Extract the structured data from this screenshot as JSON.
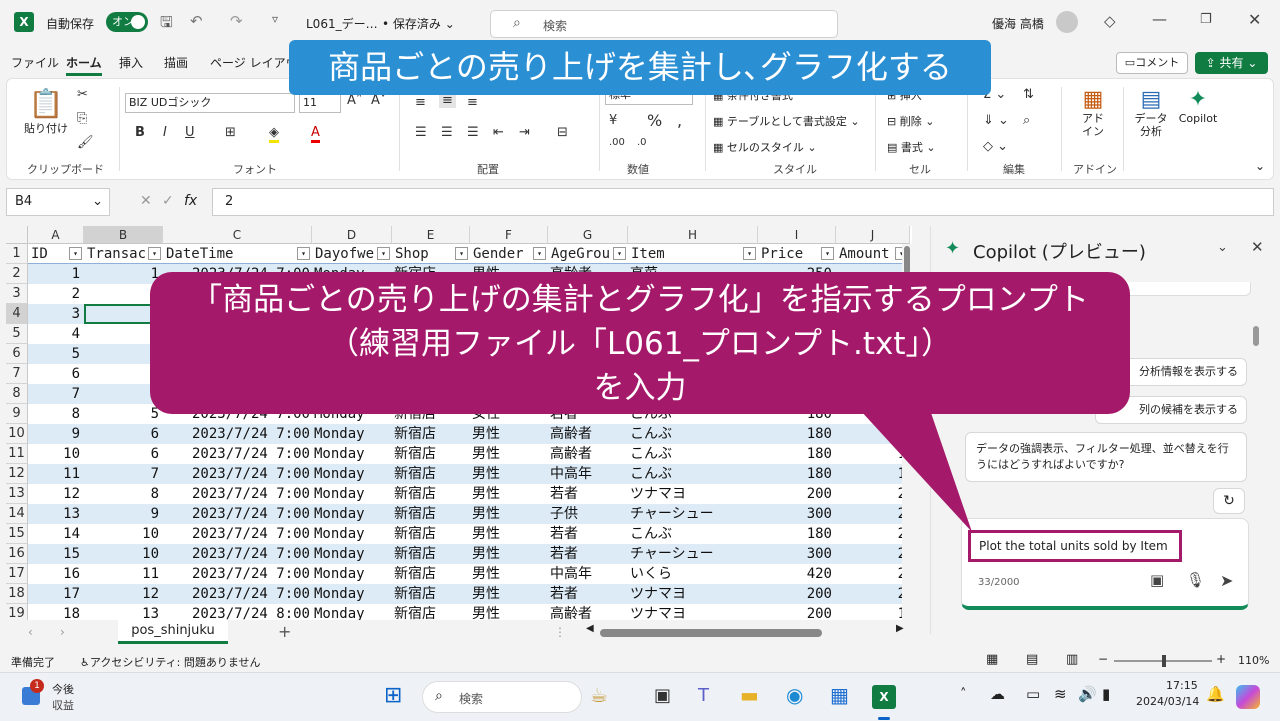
{
  "titlebar": {
    "autosave_label": "自動保存",
    "autosave_state": "オン",
    "filename": "L061_デー…",
    "save_status": "• 保存済み",
    "search_placeholder": "検索",
    "user_name": "優海 高橋"
  },
  "menu": {
    "tabs": [
      "ファイル",
      "ホーム",
      "挿入",
      "描画",
      "ページ レイアウ"
    ],
    "active": "ホーム",
    "comment_btn": "コメント",
    "share_btn": "共有"
  },
  "ribbon": {
    "paste": "貼り付け",
    "clipboard": "クリップボード",
    "font_name": "BIZ UDゴシック",
    "font_size": "11",
    "font_group": "フォント",
    "align_group": "配置",
    "number_format": "標準",
    "number_group": "数値",
    "cond_format": "条件付き書式",
    "table_format": "テーブルとして書式設定",
    "cell_style": "セルのスタイル",
    "style_group": "スタイル",
    "insert": "挿入",
    "delete": "削除",
    "format": "書式",
    "cell_group": "セル",
    "edit_group": "編集",
    "addin": "アド\nイン",
    "addin_group": "アドイン",
    "data_analysis": "データ\n分析",
    "copilot": "Copilot"
  },
  "formula_bar": {
    "name_box": "B4",
    "fx": "fx",
    "value": "2"
  },
  "grid": {
    "columns": [
      "A",
      "B",
      "C",
      "D",
      "E",
      "F",
      "G",
      "H",
      "I",
      "J"
    ],
    "headers": [
      "ID",
      "Transac",
      "DateTime",
      "Dayofwe",
      "Shop",
      "Gender",
      "AgeGrou",
      "Item",
      "Price",
      "Amount"
    ],
    "rows": [
      {
        "n": "2",
        "cells": [
          "1",
          "1",
          "2023/7/24 7:00",
          "Monday",
          "新宿店",
          "男性",
          "高齢者",
          "高菜",
          "250",
          ""
        ]
      },
      {
        "n": "3",
        "cells": [
          "2",
          "",
          "",
          "",
          "",
          "",
          "",
          "",
          "",
          ""
        ]
      },
      {
        "n": "4",
        "cells": [
          "3",
          "",
          "",
          "",
          "",
          "",
          "",
          "",
          "",
          ""
        ]
      },
      {
        "n": "5",
        "cells": [
          "4",
          "",
          "",
          "",
          "",
          "",
          "",
          "",
          "",
          ""
        ]
      },
      {
        "n": "6",
        "cells": [
          "5",
          "",
          "",
          "",
          "",
          "",
          "",
          "",
          "",
          ""
        ]
      },
      {
        "n": "7",
        "cells": [
          "6",
          "",
          "",
          "",
          "",
          "",
          "",
          "",
          "",
          ""
        ]
      },
      {
        "n": "8",
        "cells": [
          "7",
          "",
          "",
          "",
          "",
          "",
          "",
          "",
          "",
          ""
        ]
      },
      {
        "n": "9",
        "cells": [
          "8",
          "5",
          "2023/7/24 7:00",
          "Monday",
          "新宿店",
          "女性",
          "若者",
          "こんぶ",
          "180",
          ""
        ]
      },
      {
        "n": "10",
        "cells": [
          "9",
          "6",
          "2023/7/24 7:00",
          "Monday",
          "新宿店",
          "男性",
          "高齢者",
          "こんぶ",
          "180",
          "3"
        ]
      },
      {
        "n": "11",
        "cells": [
          "10",
          "6",
          "2023/7/24 7:00",
          "Monday",
          "新宿店",
          "男性",
          "高齢者",
          "こんぶ",
          "180",
          "1"
        ]
      },
      {
        "n": "12",
        "cells": [
          "11",
          "7",
          "2023/7/24 7:00",
          "Monday",
          "新宿店",
          "男性",
          "中高年",
          "こんぶ",
          "180",
          "1"
        ]
      },
      {
        "n": "13",
        "cells": [
          "12",
          "8",
          "2023/7/24 7:00",
          "Monday",
          "新宿店",
          "男性",
          "若者",
          "ツナマヨ",
          "200",
          "2"
        ]
      },
      {
        "n": "14",
        "cells": [
          "13",
          "9",
          "2023/7/24 7:00",
          "Monday",
          "新宿店",
          "男性",
          "子供",
          "チャーシュー",
          "300",
          "2"
        ]
      },
      {
        "n": "15",
        "cells": [
          "14",
          "10",
          "2023/7/24 7:00",
          "Monday",
          "新宿店",
          "男性",
          "若者",
          "こんぶ",
          "180",
          "2"
        ]
      },
      {
        "n": "16",
        "cells": [
          "15",
          "10",
          "2023/7/24 7:00",
          "Monday",
          "新宿店",
          "男性",
          "若者",
          "チャーシュー",
          "300",
          "2"
        ]
      },
      {
        "n": "17",
        "cells": [
          "16",
          "11",
          "2023/7/24 7:00",
          "Monday",
          "新宿店",
          "男性",
          "中高年",
          "いくら",
          "420",
          "2"
        ]
      },
      {
        "n": "18",
        "cells": [
          "17",
          "12",
          "2023/7/24 7:00",
          "Monday",
          "新宿店",
          "男性",
          "若者",
          "ツナマヨ",
          "200",
          "2"
        ]
      },
      {
        "n": "19",
        "cells": [
          "18",
          "13",
          "2023/7/24 8:00",
          "Monday",
          "新宿店",
          "男性",
          "高齢者",
          "ツナマヨ",
          "200",
          "1"
        ]
      }
    ]
  },
  "sheet_tab": "pos_shinjuku",
  "status": {
    "ready": "準備完了",
    "accessibility": "アクセシビリティ: 問題ありません",
    "zoom": "110%"
  },
  "copilot": {
    "title": "Copilot (プレビュー)",
    "chip1": "分析情報を表示する",
    "chip2": "列の候補を表示する",
    "chip3": "データの強調表示、フィルター処理、並べ替えを行うにはどうすればよいですか?",
    "prompt": "Plot the total units sold by Item",
    "counter": "33/2000"
  },
  "overlay": {
    "banner": "商品ごとの売り上げを集計し､グラフ化する",
    "callout_line1": "「商品ごとの売り上げの集計とグラフ化」を指示するプロンプト",
    "callout_line2": "（練習用ファイル「L061_プロンプト.txt」）",
    "callout_line3": "を入力"
  },
  "taskbar": {
    "weather_temp": "今後",
    "weather_label": "収益",
    "badge": "1",
    "search": "検索",
    "time": "17:15",
    "date": "2024/03/14"
  },
  "colors": {
    "excel_green": "#107c41",
    "banner_blue": "#2b8fd4",
    "callout_magenta": "#a5196a",
    "row_band": "#ddebf7"
  }
}
